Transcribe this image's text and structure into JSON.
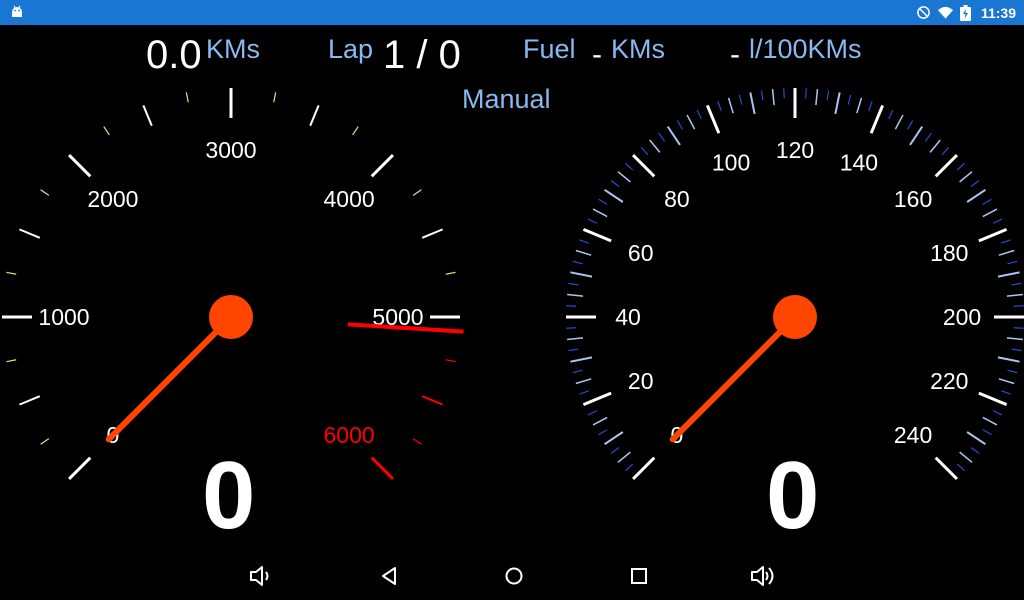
{
  "status_bar": {
    "time": "11:39"
  },
  "header": {
    "distance_value": "0.0",
    "distance_unit": "KMs",
    "lap_label": "Lap",
    "lap_value": "1 / 0",
    "fuel_label": "Fuel",
    "fuel_range_value": "-",
    "fuel_range_unit": "KMs",
    "consumption_value": "-",
    "consumption_unit": "l/100KMs",
    "mode": "Manual"
  },
  "tachometer": {
    "tick_labels": [
      "0",
      "1000",
      "2000",
      "3000",
      "4000",
      "5000",
      "6000"
    ],
    "redline_label": "6000",
    "needle_value": 0,
    "redline_marker_value": 5080,
    "digital_value": "0",
    "colors": {
      "needle": "#ff4500",
      "redline": "#ff0000",
      "minor_tick": "#e8e07a"
    }
  },
  "speedometer": {
    "tick_labels": [
      "0",
      "20",
      "40",
      "60",
      "80",
      "100",
      "120",
      "140",
      "160",
      "180",
      "200",
      "220",
      "240"
    ],
    "needle_value": 0,
    "digital_value": "0",
    "colors": {
      "needle": "#ff4500",
      "minor_tick_a": "#1f4fd6",
      "minor_tick_b": "#a8c8f0"
    }
  },
  "navigation": {
    "icons": [
      "volume-down-icon",
      "back-icon",
      "home-icon",
      "recents-icon",
      "volume-up-icon"
    ]
  }
}
